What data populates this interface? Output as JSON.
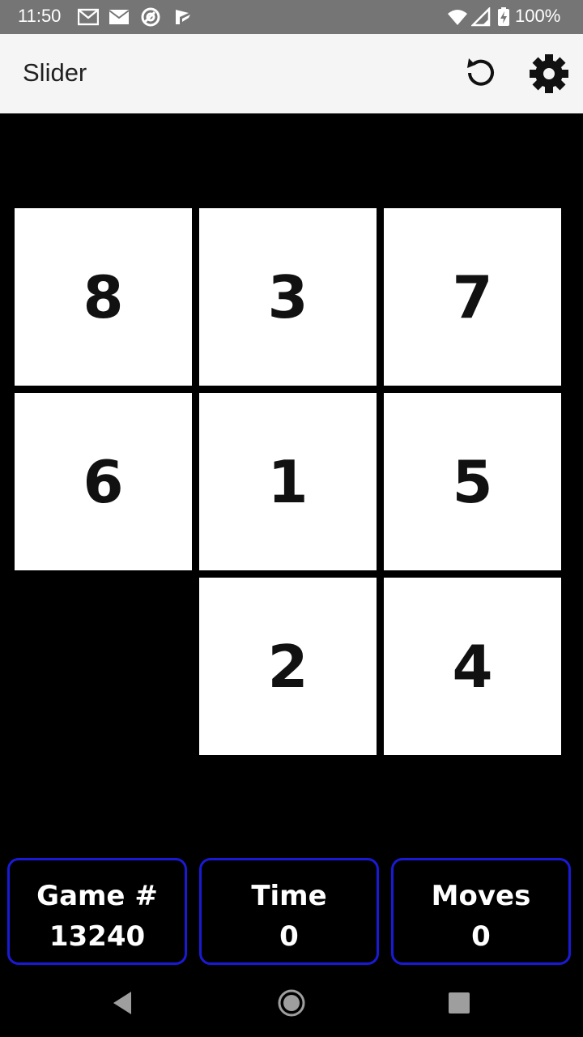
{
  "status_bar": {
    "time": "11:50",
    "battery": "100%",
    "notification_icons": [
      "gmail-icon",
      "mail-icon",
      "vpn-icon",
      "play-store-icon"
    ],
    "system_icons": [
      "wifi-icon",
      "signal-icon",
      "battery-charging-icon"
    ]
  },
  "app_bar": {
    "title": "Slider",
    "actions": [
      {
        "name": "restart-icon"
      },
      {
        "name": "settings-icon"
      }
    ]
  },
  "board": {
    "rows": 3,
    "cols": 3,
    "tiles": [
      [
        "8",
        "3",
        "7"
      ],
      [
        "6",
        "1",
        "5"
      ],
      [
        "",
        "2",
        "4"
      ]
    ]
  },
  "stats": {
    "game": {
      "label": "Game #",
      "value": "13240"
    },
    "time": {
      "label": "Time",
      "value": "0"
    },
    "moves": {
      "label": "Moves",
      "value": "0"
    }
  },
  "nav_bar": {
    "buttons": [
      "back-icon",
      "home-icon",
      "recents-icon"
    ]
  },
  "colors": {
    "status_bar": "#757575",
    "app_bar": "#f5f5f5",
    "background": "#000000",
    "tile": "#ffffff",
    "stat_border": "#1a1ad6"
  }
}
